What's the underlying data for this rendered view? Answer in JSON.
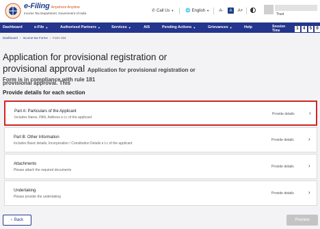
{
  "header": {
    "logo_title": "e-Filing",
    "logo_hindi": "Anywhere Anytime",
    "logo_sub": "Income Tax Department, Government of India",
    "call_us": "Call Us",
    "language": "English",
    "font_decrease": "A-",
    "font_normal": "A",
    "font_increase": "A+",
    "user_type": "Trust"
  },
  "nav": {
    "items": [
      {
        "label": "Dashboard",
        "has_dropdown": false
      },
      {
        "label": "e-File",
        "has_dropdown": true
      },
      {
        "label": "Authorised Partners",
        "has_dropdown": true
      },
      {
        "label": "Services",
        "has_dropdown": true
      },
      {
        "label": "AIS",
        "has_dropdown": false
      },
      {
        "label": "Pending Actions",
        "has_dropdown": true
      },
      {
        "label": "Grievances",
        "has_dropdown": true
      },
      {
        "label": "Help",
        "has_dropdown": false
      }
    ],
    "session_label": "Session Time",
    "session_digits": [
      "1",
      "4",
      "5",
      "0"
    ]
  },
  "breadcrumb": [
    "Dashboard",
    "Income-tax Forms",
    "Form 104"
  ],
  "page": {
    "title": "Application for provisional registration or provisional approval",
    "subtitle": "Application for provisional registration or provisional approval. This",
    "note": "Form is in compliance with rule 181",
    "section_heading": "Provide details for each section"
  },
  "sections": [
    {
      "title": "Part A: Particulars of the Applicant",
      "desc": "Includes Name, PAN, Address e.t.c of the applicant",
      "action": "Provide details",
      "highlighted": true
    },
    {
      "title": "Part B: Other Information",
      "desc": "Includes Basic details, Incorporation / Constitution Details e.t.c of the applicant",
      "action": "Provide details",
      "highlighted": false
    },
    {
      "title": "Attachments",
      "desc": "Please attach the required documents",
      "action": "Provide details",
      "highlighted": false
    },
    {
      "title": "Undertaking",
      "desc": "Please provide the undertaking",
      "action": "Provide details",
      "highlighted": false
    }
  ],
  "footer": {
    "back_label": "Back",
    "preview_label": "Preview"
  },
  "colors": {
    "brand_blue": "#23358c",
    "highlight_red": "#d32222"
  }
}
